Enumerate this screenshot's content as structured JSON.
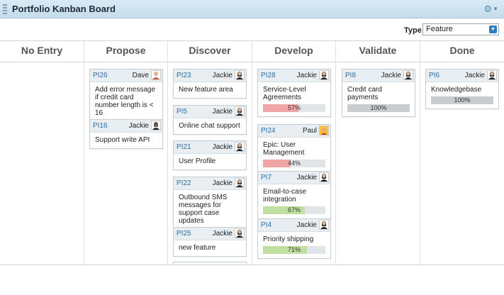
{
  "header": {
    "title": "Portfolio Kanban Board",
    "settings_icon": "gear-icon"
  },
  "filter": {
    "type_label": "Type",
    "type_value": "Feature"
  },
  "columns": [
    {
      "name": "No Entry"
    },
    {
      "name": "Propose"
    },
    {
      "name": "Discover"
    },
    {
      "name": "Develop"
    },
    {
      "name": "Validate"
    },
    {
      "name": "Done"
    }
  ],
  "cards": {
    "pi26": {
      "id": "PI26",
      "owner": "Dave",
      "title": "Add error message if credit card number length is < 16"
    },
    "pi16": {
      "id": "PI16",
      "owner": "Jackie",
      "title": "Support write API"
    },
    "pi23": {
      "id": "PI23",
      "owner": "Jackie",
      "title": "New feature area"
    },
    "pi5": {
      "id": "PI5",
      "owner": "Jackie",
      "title": "Online chat support"
    },
    "pi21": {
      "id": "PI21",
      "owner": "Jackie",
      "title": "User Profile"
    },
    "pi22": {
      "id": "PI22",
      "owner": "Jackie",
      "title": "Outbound SMS messages for support case updates"
    },
    "pi25": {
      "id": "PI25",
      "owner": "Jackie",
      "title": "new feature"
    },
    "pi28": {
      "id": "PI28",
      "owner": "Jackie",
      "title": "Service-Level Agreements",
      "progress": "57%",
      "progress_value": 0.57,
      "progress_color": "#f0a6a6"
    },
    "pi24": {
      "id": "PI24",
      "owner": "Paul",
      "title": "Epic: User Management",
      "progress": "44%",
      "progress_value": 0.44,
      "progress_color": "#f0a6a6"
    },
    "pi7": {
      "id": "PI7",
      "owner": "Jackie",
      "title": "Email-to-case integration",
      "progress": "67%",
      "progress_value": 0.67,
      "progress_color": "#bfe0a0"
    },
    "pi4": {
      "id": "PI4",
      "owner": "Jackie",
      "title": "Priority shipping",
      "progress": "71%",
      "progress_value": 0.71,
      "progress_color": "#bfe0a0"
    },
    "pi8": {
      "id": "PI8",
      "owner": "Jackie",
      "title": "Credit card payments",
      "progress": "100%",
      "progress_value": 1.0,
      "progress_color": "#c9ccce"
    },
    "pi6": {
      "id": "PI6",
      "owner": "Jackie",
      "title": "Knowledgebase",
      "progress": "100%",
      "progress_value": 1.0,
      "progress_color": "#c9ccce"
    }
  }
}
